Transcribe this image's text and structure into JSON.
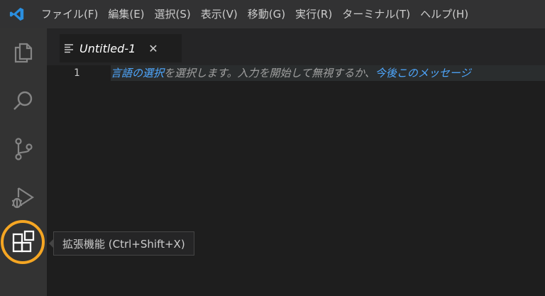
{
  "menu": {
    "items": [
      "ファイル(F)",
      "編集(E)",
      "選択(S)",
      "表示(V)",
      "移動(G)",
      "実行(R)",
      "ターミナル(T)",
      "ヘルプ(H)"
    ]
  },
  "activity": {
    "icons": [
      "files-icon",
      "search-icon",
      "source-control-icon",
      "run-debug-icon",
      "extensions-icon"
    ],
    "accent_color": "#f5a623"
  },
  "tab": {
    "label": "Untitled-1",
    "close": "✕"
  },
  "editor": {
    "line_number": "1",
    "hint": {
      "link1": "言語の選択",
      "text1": "を選択します。入力を開始して無視するか、",
      "link2": "今後このメッセージ"
    }
  },
  "tooltip": {
    "text": "拡張機能 (Ctrl+Shift+X)"
  }
}
